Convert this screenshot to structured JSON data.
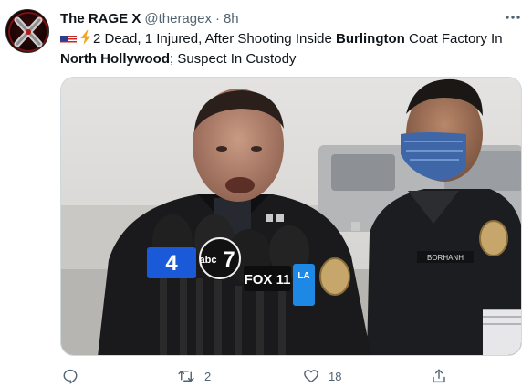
{
  "tweet": {
    "display_name": "The RAGE X",
    "handle": "@theragex",
    "separator": "·",
    "time": "8h",
    "text": {
      "part1": "2 Dead, 1 Injured, After Shooting Inside ",
      "bold1": "Burlington",
      "part2": " Coat Factory In ",
      "bold2": "North Hollywood",
      "part3": "; Suspect In Custody"
    },
    "media": {
      "name_tag": "BORHANH",
      "mic_flags": [
        "4",
        "abc",
        "7",
        "FOX 11",
        "LA"
      ]
    },
    "counts": {
      "reply": "",
      "retweet": "2",
      "like": "18"
    }
  },
  "colors": {
    "text_primary": "#0f1419",
    "text_secondary": "#536471",
    "border": "#cfd9de"
  },
  "icons": [
    "avatar-x-logo",
    "more-icon",
    "us-flag-emoji",
    "lightning-emoji",
    "reply-icon",
    "retweet-icon",
    "like-icon",
    "share-icon"
  ]
}
